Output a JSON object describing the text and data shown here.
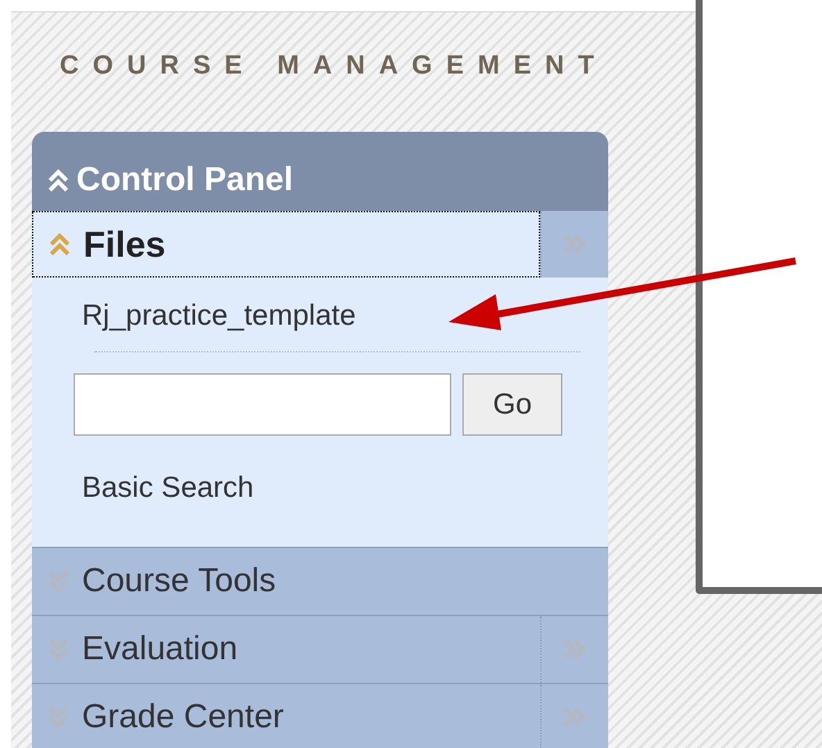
{
  "heading": "COURSE MANAGEMENT",
  "panel": {
    "title": "Control Panel",
    "expanded": true
  },
  "sections": [
    {
      "label": "Files",
      "expanded": true,
      "flyout": true,
      "items": [
        "Rj_practice_template"
      ],
      "search": {
        "button": "Go",
        "link": "Basic Search"
      }
    },
    {
      "label": "Course Tools",
      "expanded": false,
      "flyout": false
    },
    {
      "label": "Evaluation",
      "expanded": false,
      "flyout": true
    },
    {
      "label": "Grade Center",
      "expanded": false,
      "flyout": true
    }
  ]
}
